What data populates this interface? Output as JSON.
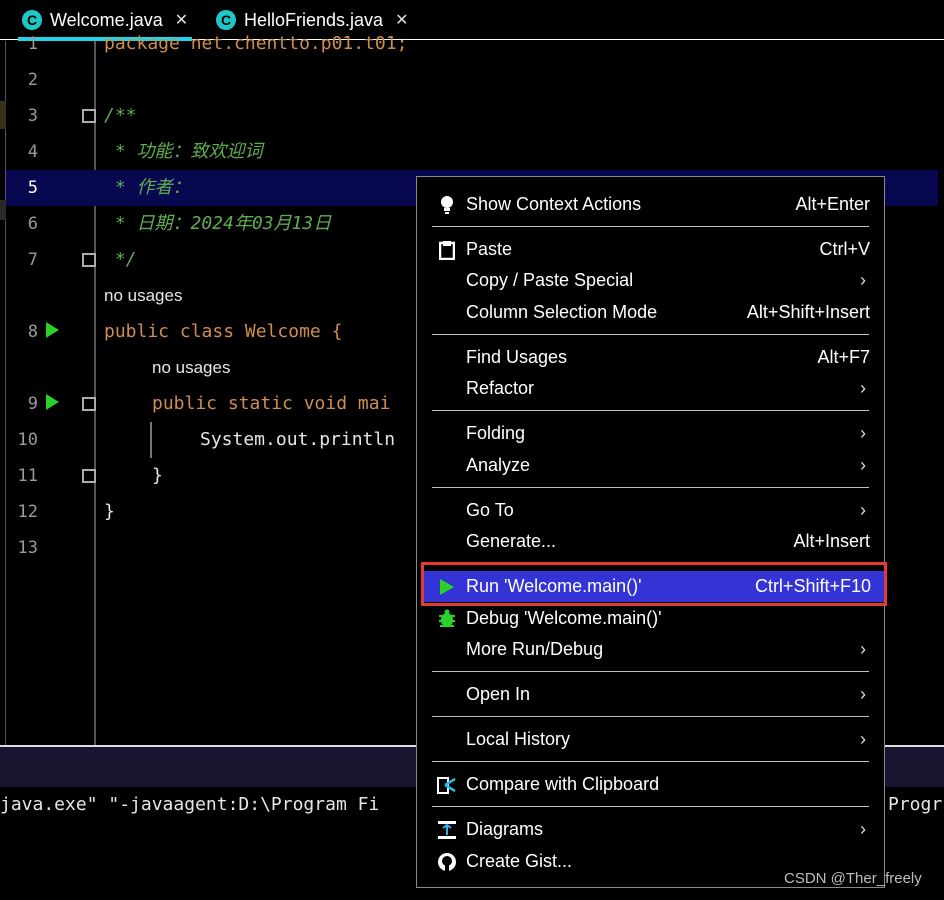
{
  "tabs": [
    {
      "label": "Welcome.java",
      "icon": "java-class-icon",
      "active": true
    },
    {
      "label": "HelloFriends.java",
      "icon": "java-class-icon",
      "active": false
    }
  ],
  "editor": {
    "lines": [
      {
        "num": "1",
        "text": "package net.chentto.p01.t01;"
      },
      {
        "num": "2",
        "text": ""
      },
      {
        "num": "3",
        "text": "/**"
      },
      {
        "num": "4",
        "text": " * 功能：致欢迎词"
      },
      {
        "num": "5",
        "text": " * 作者："
      },
      {
        "num": "6",
        "text": " * 日期：2024年03月13日"
      },
      {
        "num": "7",
        "text": " */"
      },
      {
        "num": "8",
        "text": "public class Welcome {"
      },
      {
        "num": "9",
        "text": "public static void mai"
      },
      {
        "num": "10",
        "text": "System.out.println"
      },
      {
        "num": "11",
        "text": "}"
      },
      {
        "num": "12",
        "text": "}"
      },
      {
        "num": "13",
        "text": ""
      }
    ],
    "hint_class": "no usages",
    "hint_method": "no usages"
  },
  "console": {
    "line": "java.exe\" \"-javaagent:D:\\Program Fi",
    "line_right": "Progr"
  },
  "context_menu": {
    "items": [
      {
        "label": "Show Context Actions",
        "shortcut": "Alt+Enter",
        "icon": "lightbulb-icon"
      },
      {
        "label": "Paste",
        "shortcut": "Ctrl+V",
        "icon": "clipboard-icon"
      },
      {
        "label": "Copy / Paste Special",
        "submenu": true
      },
      {
        "label": "Column Selection Mode",
        "shortcut": "Alt+Shift+Insert"
      },
      {
        "label": "Find Usages",
        "shortcut": "Alt+F7"
      },
      {
        "label": "Refactor",
        "submenu": true
      },
      {
        "label": "Folding",
        "submenu": true
      },
      {
        "label": "Analyze",
        "submenu": true
      },
      {
        "label": "Go To",
        "submenu": true
      },
      {
        "label": "Generate...",
        "shortcut": "Alt+Insert"
      },
      {
        "label": "Run 'Welcome.main()'",
        "shortcut": "Ctrl+Shift+F10",
        "icon": "run-icon",
        "selected": true
      },
      {
        "label": "Debug 'Welcome.main()'",
        "icon": "debug-bug-icon"
      },
      {
        "label": "More Run/Debug",
        "submenu": true
      },
      {
        "label": "Open In",
        "submenu": true
      },
      {
        "label": "Local History",
        "submenu": true
      },
      {
        "label": "Compare with Clipboard",
        "icon": "compare-icon"
      },
      {
        "label": "Diagrams",
        "submenu": true,
        "icon": "diagram-icon"
      },
      {
        "label": "Create Gist...",
        "icon": "github-icon"
      }
    ]
  },
  "watermark": "CSDN @Ther_freely",
  "colors": {
    "keyword": "#cf8e4e",
    "comment": "#5fae4e",
    "selection": "#3333d6",
    "highlight_line": "#080850",
    "run_green": "#28d228",
    "frame_red": "#e53935"
  }
}
